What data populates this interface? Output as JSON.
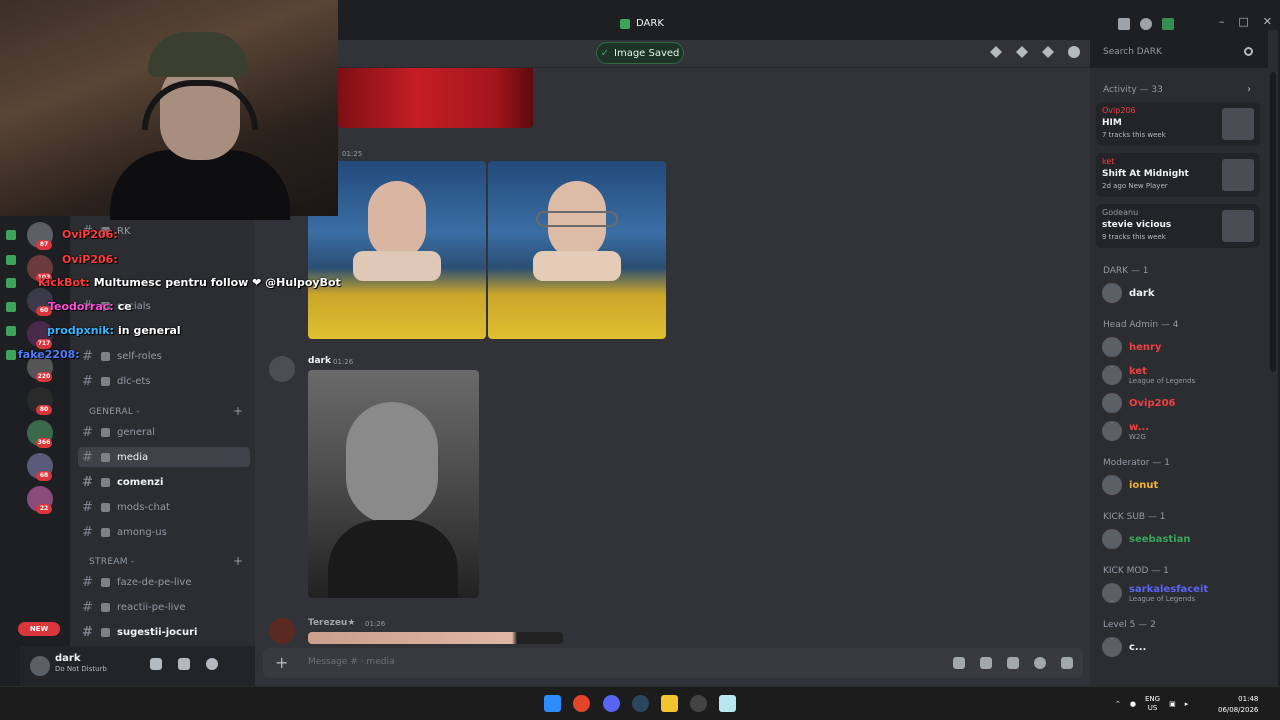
{
  "window": {
    "title": "DARK"
  },
  "toast": {
    "text": "Image Saved"
  },
  "search": {
    "placeholder": "Search DARK"
  },
  "activity": {
    "title": "Activity — 33",
    "cards": [
      {
        "user": "Ovip206",
        "track": "HIM",
        "sub": "7 tracks this week",
        "color": "#f23f43"
      },
      {
        "user": "ket",
        "track": "Shift At Midnight",
        "sub": "2d ago  New Player",
        "color": "#f23f43"
      },
      {
        "user": "Godeanu",
        "track": "stevie vicious",
        "sub": "9 tracks this week",
        "color": "#949ba4"
      }
    ]
  },
  "member_groups": [
    {
      "title": "DARK — 1",
      "members": [
        {
          "name": "dark",
          "color": "#f2f3f5",
          "sub": ""
        }
      ]
    },
    {
      "title": "Head Admin — 4",
      "members": [
        {
          "name": "henry",
          "color": "#f23f43",
          "sub": ""
        },
        {
          "name": "ket",
          "color": "#f23f43",
          "sub": "League of Legends"
        },
        {
          "name": "Ovip206",
          "color": "#f23f43",
          "sub": ""
        },
        {
          "name": "w...",
          "color": "#f23f43",
          "sub": "W2G"
        }
      ]
    },
    {
      "title": "Moderator — 1",
      "members": [
        {
          "name": "ionut",
          "color": "#f0b232",
          "sub": ""
        }
      ]
    },
    {
      "title": "KICK SUB — 1",
      "members": [
        {
          "name": "seebastian",
          "color": "#3ba55c",
          "sub": ""
        }
      ]
    },
    {
      "title": "KICK MOD — 1",
      "members": [
        {
          "name": "sarkalesfaceit",
          "color": "#5865f2",
          "sub": "League of Legends"
        }
      ]
    },
    {
      "title": "Level 5 — 2",
      "members": [
        {
          "name": "c...",
          "color": "#f2f3f5",
          "sub": ""
        }
      ]
    }
  ],
  "channels_top": [
    {
      "name": "RK"
    },
    {
      "name": "socials"
    },
    {
      "name": "self-roles"
    },
    {
      "name": "dlc-ets"
    }
  ],
  "category_general": "GENERAL -",
  "channels_general": [
    {
      "name": "general",
      "state": "normal"
    },
    {
      "name": "media",
      "state": "active"
    },
    {
      "name": "comenzi",
      "state": "unread"
    },
    {
      "name": "mods-chat",
      "state": "normal"
    },
    {
      "name": "among-us",
      "state": "normal"
    }
  ],
  "category_stream": "STREAM -",
  "channels_stream": [
    {
      "name": "faze-de-pe-live",
      "state": "normal"
    },
    {
      "name": "reactii-pe-live",
      "state": "normal"
    },
    {
      "name": "sugestii-jocuri",
      "state": "unread"
    }
  ],
  "guild_badges": [
    "87",
    "103",
    "60",
    "717",
    "220",
    "80",
    "366",
    "68",
    "22"
  ],
  "new_badge": "NEW",
  "user_panel": {
    "name": "dark",
    "status": "Do Not Disturb"
  },
  "overlay_chat": [
    {
      "user": "OviP206:",
      "text": "",
      "color": "#ff3b3b"
    },
    {
      "user": "OviP206:",
      "text": "",
      "color": "#ff3b3b"
    },
    {
      "user": "KickBot:",
      "text": "Multumesc pentru follow ❤ @HulpoyBot",
      "color": "#ff3b3b"
    },
    {
      "user": "Teodorrac:",
      "text": "ce",
      "color": "#ff4fd8"
    },
    {
      "user": "prodpxnik:",
      "text": "in general",
      "color": "#37b6ff"
    },
    {
      "user": "fake2208:",
      "text": "",
      "color": "#4f7dff"
    }
  ],
  "messages": [
    {
      "time": "01:25"
    },
    {
      "author": "dark",
      "time": "01:26"
    },
    {
      "author": "Terezeu★",
      "time": "01:26"
    }
  ],
  "composer": {
    "placeholder": "Message #  · media"
  },
  "taskbar": {
    "lang1": "ENG",
    "lang2": "US",
    "time": "01:48",
    "date": "06/08/2026"
  }
}
